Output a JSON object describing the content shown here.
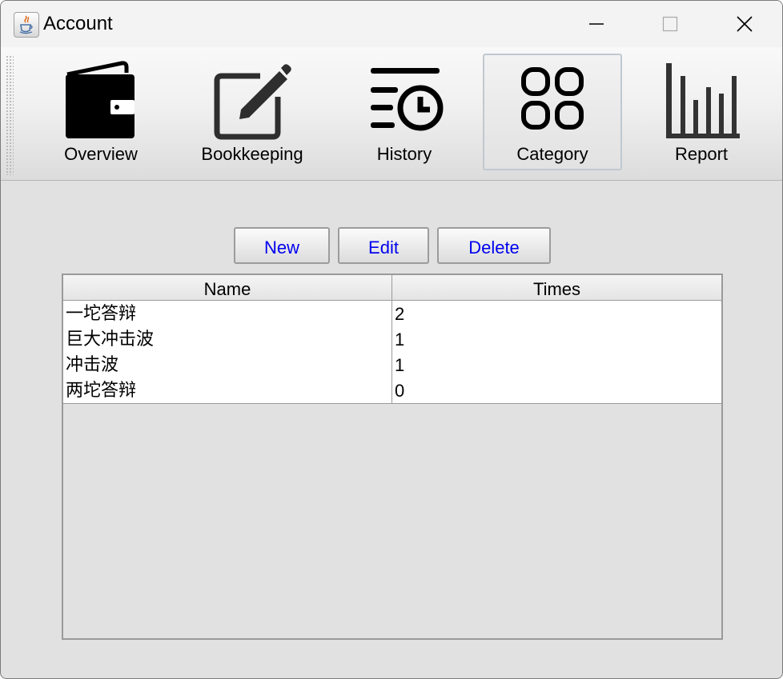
{
  "window": {
    "title": "Account"
  },
  "toolbar": {
    "items": [
      {
        "label": "Overview",
        "icon": "wallet-icon"
      },
      {
        "label": "Bookkeeping",
        "icon": "edit-icon"
      },
      {
        "label": "History",
        "icon": "history-icon"
      },
      {
        "label": "Category",
        "icon": "category-icon",
        "selected": true
      },
      {
        "label": "Report",
        "icon": "bar-chart-icon"
      }
    ]
  },
  "actions": {
    "new_label": "New",
    "edit_label": "Edit",
    "delete_label": "Delete",
    "color": "#0000ee"
  },
  "table": {
    "columns": [
      "Name",
      "Times"
    ],
    "rows": [
      {
        "name": "一坨答辩",
        "times": "2"
      },
      {
        "name": "巨大冲击波",
        "times": "1"
      },
      {
        "name": "冲击波",
        "times": "1"
      },
      {
        "name": "两坨答辩",
        "times": "0"
      }
    ]
  }
}
